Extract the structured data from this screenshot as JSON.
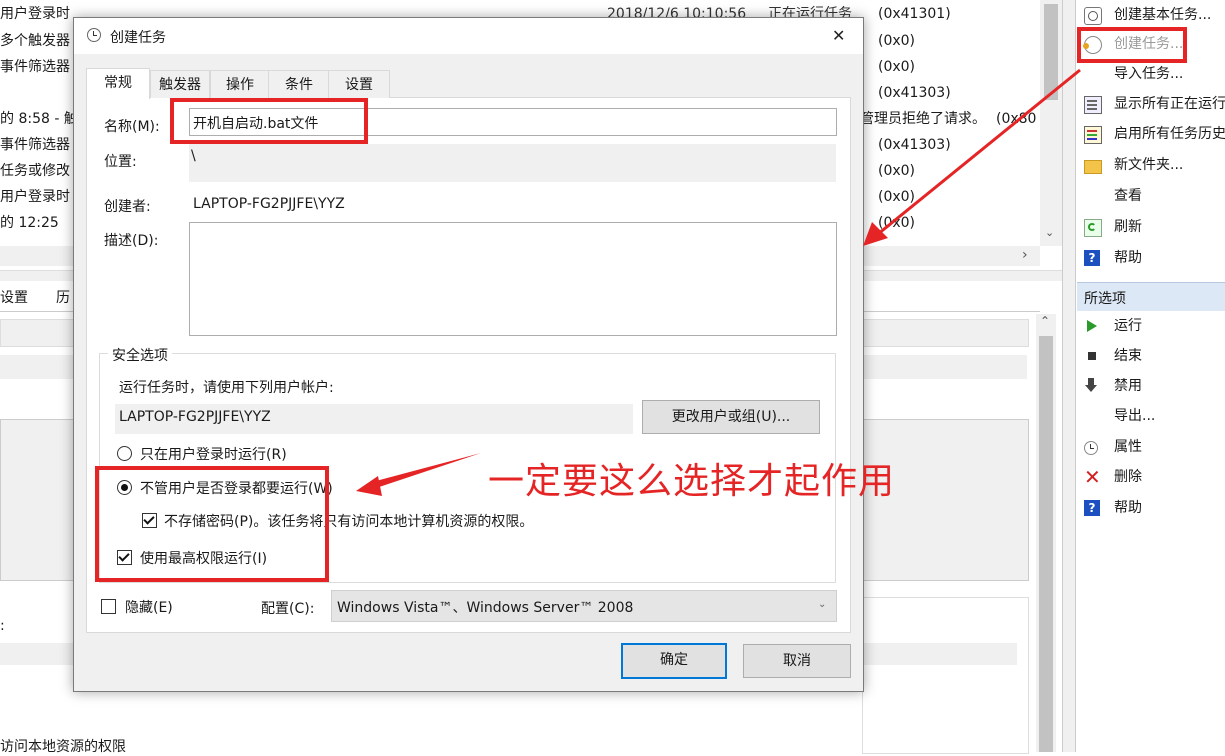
{
  "background": {
    "list_rows": [
      {
        "left": "用户登录时",
        "date": "2018/12/6 10:10:56",
        "status": "正在运行任务",
        "code": "(0x41301)"
      },
      {
        "left": "多个触发器",
        "date": "",
        "status": "",
        "code": "(0x0)"
      },
      {
        "left": "事件筛选器",
        "date": "",
        "status": "",
        "code": "(0x0)"
      },
      {
        "left": "",
        "date": "",
        "status": "",
        "code": "(0x41303)"
      },
      {
        "left": "的 8:58 - 触",
        "date": "",
        "status": "管理员拒绝了请求。",
        "code": "(0x80"
      },
      {
        "left": "事件筛选器",
        "date": "",
        "status": "",
        "code": "(0x41303)"
      },
      {
        "left": "任务或修改",
        "date": "",
        "status": "",
        "code": "(0x0)"
      },
      {
        "left": "用户登录时",
        "date": "",
        "status": "",
        "code": "(0x0)"
      },
      {
        "left": "的 12:25",
        "date": "",
        "status": "",
        "code": "(0x0)"
      }
    ],
    "tabs": [
      "设置",
      "历"
    ],
    "bottom_text": "访问本地资源的权限",
    "colon": ":"
  },
  "actions": {
    "items": [
      {
        "label": "创建基本任务...",
        "icon": "wizard-icon"
      },
      {
        "label": "创建任务...",
        "icon": "create-task-icon"
      },
      {
        "label": "导入任务...",
        "icon": ""
      },
      {
        "label": "显示所有正在运行",
        "icon": "running-list-icon"
      },
      {
        "label": "启用所有任务历史",
        "icon": "history-icon"
      },
      {
        "label": "新文件夹...",
        "icon": "folder-icon"
      },
      {
        "label": "查看",
        "icon": ""
      },
      {
        "label": "刷新",
        "icon": "refresh-icon"
      },
      {
        "label": "帮助",
        "icon": "help-icon"
      }
    ],
    "section_header": "所选项",
    "selected_items": [
      {
        "label": "运行",
        "icon": "run-icon"
      },
      {
        "label": "结束",
        "icon": "stop-icon"
      },
      {
        "label": "禁用",
        "icon": "disable-icon"
      },
      {
        "label": "导出...",
        "icon": ""
      },
      {
        "label": "属性",
        "icon": "properties-icon"
      },
      {
        "label": "删除",
        "icon": "delete-icon"
      },
      {
        "label": "帮助",
        "icon": "help-icon"
      }
    ]
  },
  "dialog": {
    "title": "创建任务",
    "close": "✕",
    "tabs": [
      "常规",
      "触发器",
      "操作",
      "条件",
      "设置"
    ],
    "name_label": "名称(M):",
    "name_value": "开机自启动.bat文件",
    "location_label": "位置:",
    "location_value": "\\",
    "author_label": "创建者:",
    "author_value": "LAPTOP-FG2PJJFE\\YYZ",
    "description_label": "描述(D):",
    "description_value": "",
    "security_group": "安全选项",
    "run_as_prompt": "运行任务时，请使用下列用户帐户:",
    "run_as_user": "LAPTOP-FG2PJJFE\\YYZ",
    "change_user_button": "更改用户或组(U)...",
    "radio_logged_on": "只在用户登录时运行(R)",
    "radio_whether": "不管用户是否登录都要运行(W)",
    "no_store_password": "不存储密码(P)。该任务将只有访问本地计算机资源的权限。",
    "highest_privileges": "使用最高权限运行(I)",
    "hidden_label": "隐藏(E)",
    "configure_label": "配置(C):",
    "configure_value": "Windows Vista™、Windows Server™ 2008",
    "ok_button": "确定",
    "cancel_button": "取消",
    "radio_logged_on_selected": false,
    "radio_whether_selected": true,
    "no_store_password_checked": true,
    "highest_privileges_checked": true,
    "hidden_checked": false
  },
  "annotation": {
    "text": "一定要这么选择才起作用",
    "color": "#e52525"
  }
}
